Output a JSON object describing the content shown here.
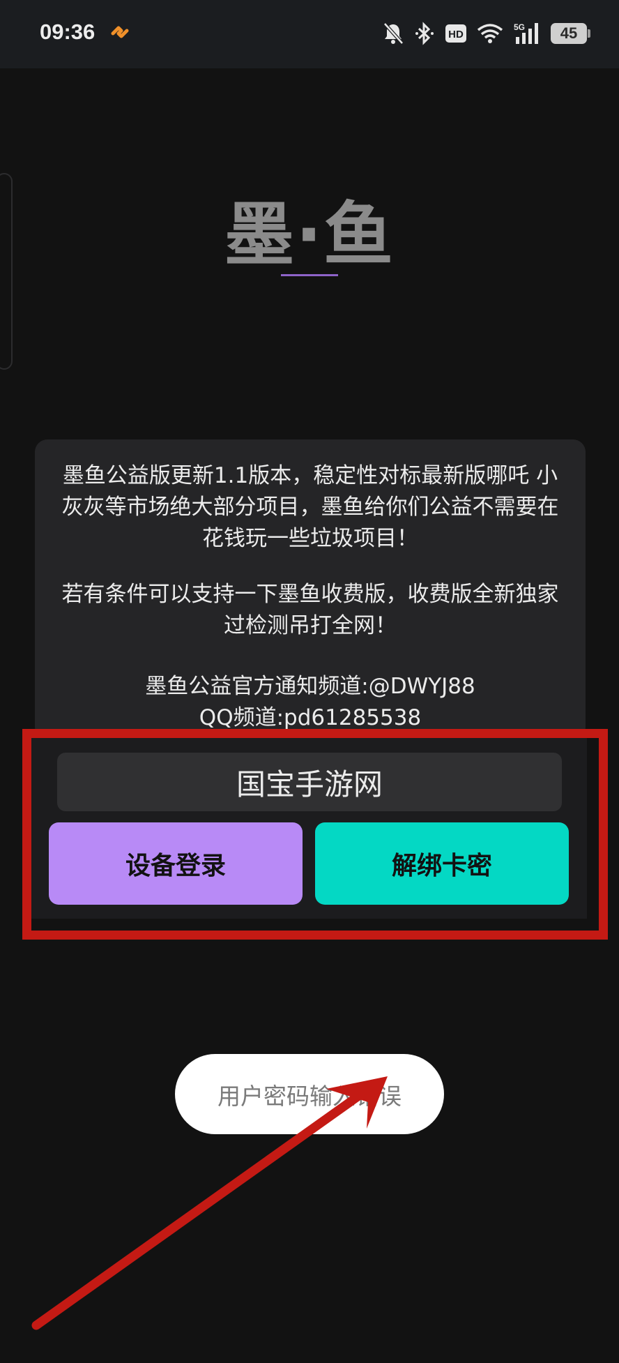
{
  "status_bar": {
    "time": "09:36",
    "battery": "45",
    "icons": [
      "bell-muted-icon",
      "bluetooth-icon",
      "hd-icon",
      "wifi-icon",
      "signal-5g-icon"
    ]
  },
  "app": {
    "title": "墨·鱼"
  },
  "notice": {
    "paragraph1": "墨鱼公益版更新1.1版本，稳定性对标最新版哪吒 小灰灰等市场绝大部分项目，墨鱼给你们公益不需要在花钱玩一些垃圾项目！",
    "paragraph2": "若有条件可以支持一下墨鱼收费版，收费版全新独家过检测吊打全网！",
    "channel_line": "墨鱼公益官方通知频道:@DWYJ88",
    "qq_line": "QQ频道:pd61285538"
  },
  "login": {
    "card_value": "国宝手游网",
    "device_login_label": "设备登录",
    "unbind_label": "解绑卡密"
  },
  "toast": {
    "message": "用户密码输入错误"
  },
  "colors": {
    "accent_purple": "#b88af6",
    "accent_teal": "#04d8c4",
    "highlight_red": "#c41a14"
  }
}
